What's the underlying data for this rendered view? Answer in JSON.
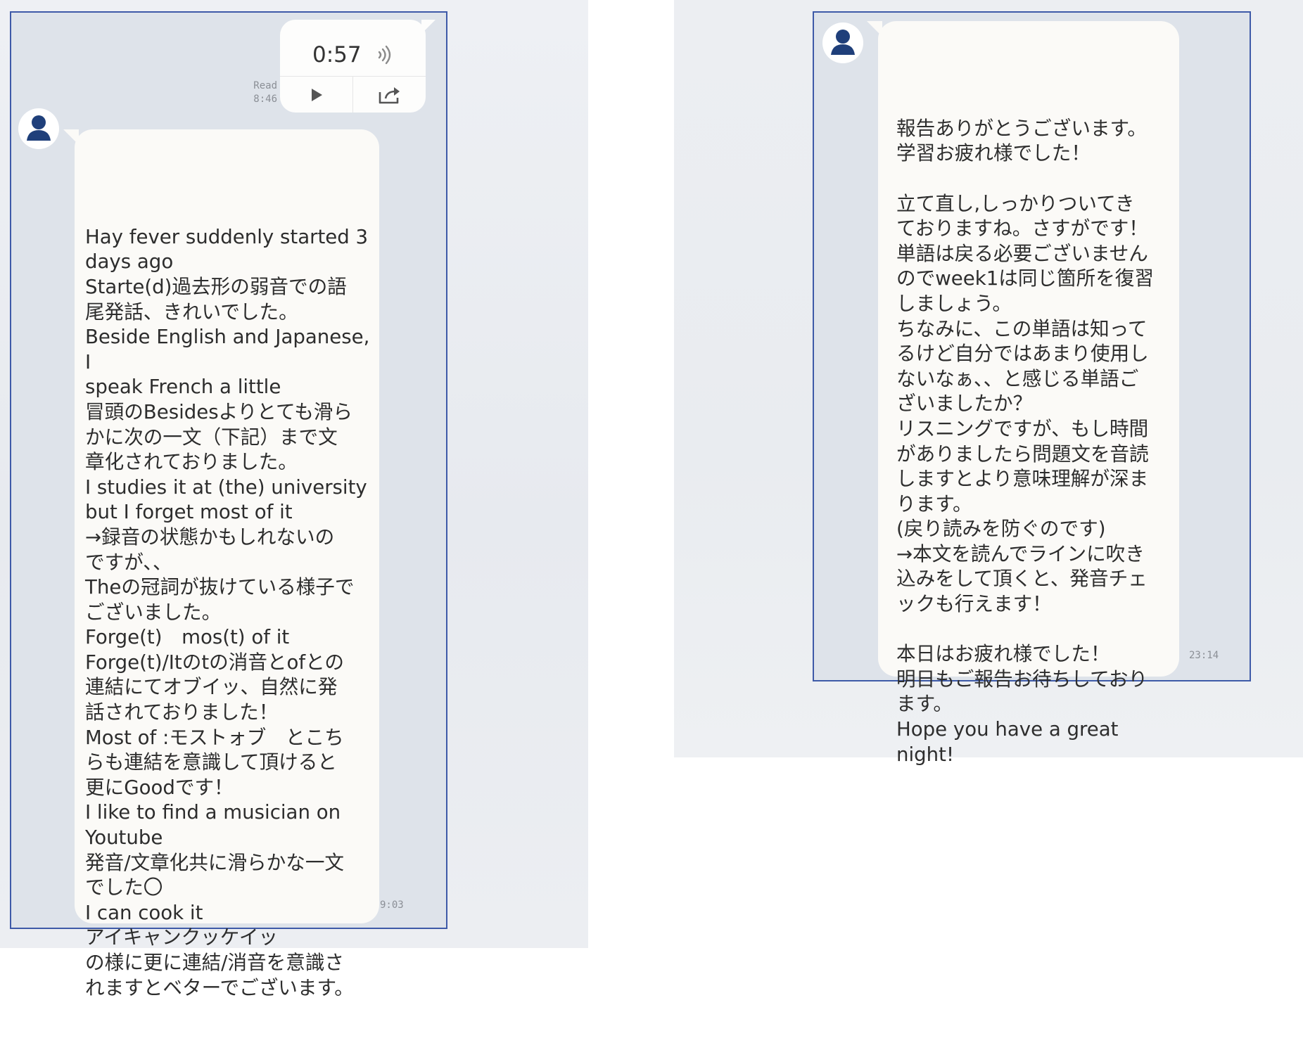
{
  "left_chat": {
    "voice_message": {
      "duration": "0:57",
      "read_label": "Read",
      "read_time": "8:46",
      "play_icon": "play-icon",
      "share_icon": "share-icon",
      "sound_icon": "sound-wave-icon"
    },
    "message": {
      "text": "Hay fever suddenly started 3\ndays ago\nStarte(d)過去形の弱音での語\n尾発話、きれいでした。\nBeside English and Japanese, I\nspeak French a little\n冒頭のBesidesよりとても滑ら\nかに次の一文（下記）まで文\n章化されておりました。\nI studies it at (the) university\nbut I forget most of it\n→録音の状態かもしれないの\nですが、、\nTheの冠詞が抜けている様子で\nございました。\nForge(t)　mos(t) of it\nForge(t)/Itのtの消音とofとの\n連結にてオブイッ、自然に発\n話されておりました！\nMost of :モストォブ　とこち\nらも連結を意識して頂けると\n更にGoodです！\nI like to find a musician on\nYoutube\n発音/文章化共に滑らかな一文\nでした〇\nI can cook it\nアイキャンクッケイッ\nの様に更に連結/消音を意識さ\nれますとベターでございます。",
      "time": "9:03"
    }
  },
  "right_chat": {
    "message": {
      "text": "報告ありがとうございます。\n学習お疲れ様でした！\n\n立て直し,しっかりついてき\nておりますね。さすがです！\n単語は戻る必要ございません\nのでweek1は同じ箇所を復習\nしましょう。\nちなみに、この単語は知って\nるけど自分ではあまり使用し\nないなぁ、、と感じる単語ご\nざいましたか？\nリスニングですが、もし時間\nがありましたら問題文を音読\nしますとより意味理解が深ま\nります。\n(戻り読みを防ぐのです)\n→本文を読んでラインに吹き\n込みをして頂くと、発音チェ\nックも行えます！\n\n本日はお疲れ様でした！\n明日もご報告お待ちしており\nます。\nHope you have a great\nnight!",
      "time": "23:14"
    }
  },
  "colors": {
    "frame_border": "#3e5aa8",
    "chat_background": "#dee3ea",
    "bubble": "#fbfaf7",
    "avatar_figure": "#1f3f7a"
  }
}
